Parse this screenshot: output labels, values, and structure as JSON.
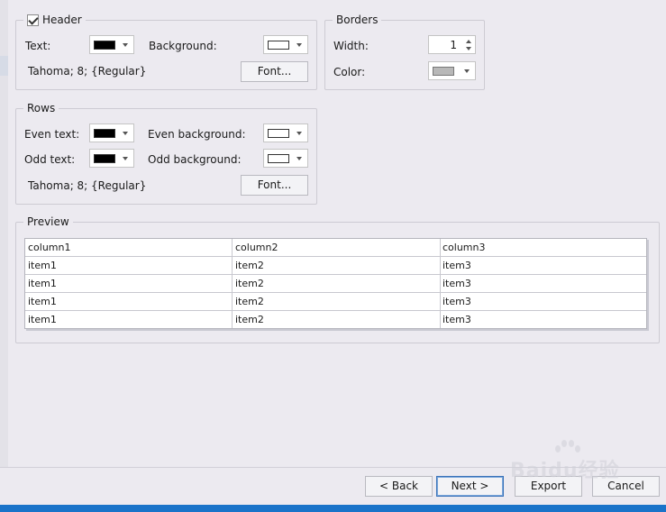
{
  "header_group": {
    "title": "Header",
    "checked": true,
    "text_label": "Text:",
    "background_label": "Background:",
    "text_color": "#000000",
    "background_color": "#ffffff",
    "font_desc": "Tahoma; 8; {Regular}",
    "font_button": "Font..."
  },
  "borders_group": {
    "title": "Borders",
    "width_label": "Width:",
    "width_value": "1",
    "color_label": "Color:",
    "color_value": "#b8b8b8"
  },
  "rows_group": {
    "title": "Rows",
    "even_text_label": "Even text:",
    "even_background_label": "Even background:",
    "odd_text_label": "Odd text:",
    "odd_background_label": "Odd background:",
    "even_text_color": "#000000",
    "even_background_color": "#ffffff",
    "odd_text_color": "#000000",
    "odd_background_color": "#ffffff",
    "font_desc": "Tahoma; 8; {Regular}",
    "font_button": "Font..."
  },
  "preview": {
    "title": "Preview",
    "columns": [
      "column1",
      "column2",
      "column3"
    ],
    "rows": [
      [
        "item1",
        "item2",
        "item3"
      ],
      [
        "item1",
        "item2",
        "item3"
      ],
      [
        "item1",
        "item2",
        "item3"
      ],
      [
        "item1",
        "item2",
        "item3"
      ]
    ]
  },
  "footer": {
    "back": "< Back",
    "next": "Next >",
    "export": "Export",
    "cancel": "Cancel"
  },
  "watermark": {
    "text": "Baidu经验",
    "icon": "baidu-paw-icon"
  }
}
